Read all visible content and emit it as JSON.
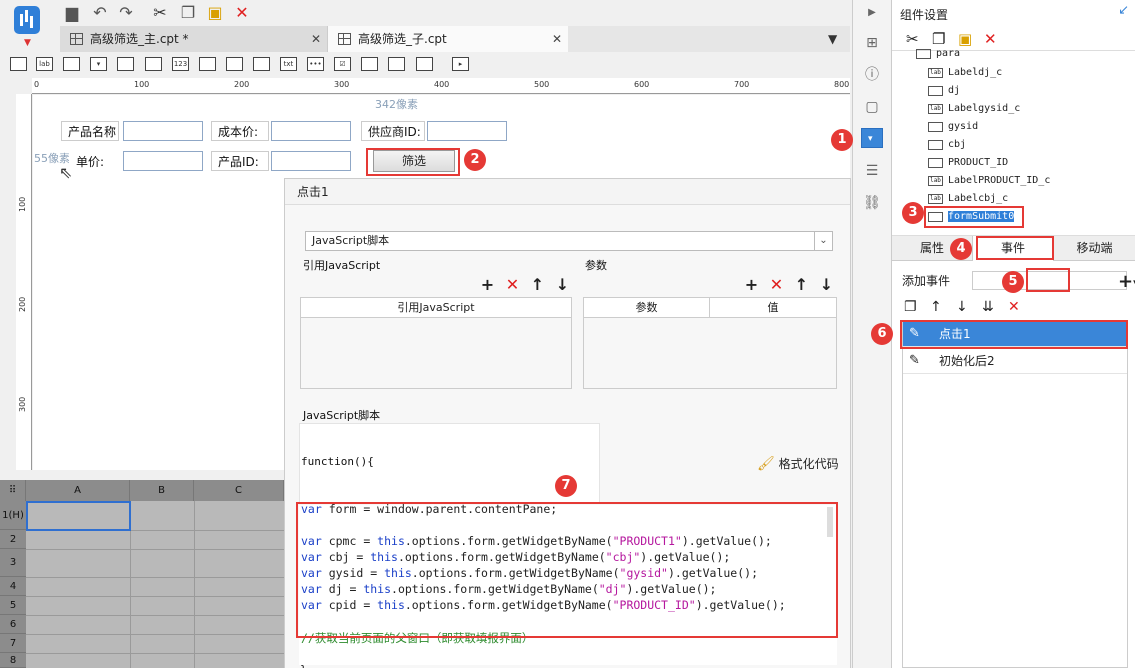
{
  "tabs": [
    {
      "label": "高级筛选_主.cpt *"
    },
    {
      "label": "高级筛选_子.cpt"
    }
  ],
  "ruler": {
    "top_ticks": [
      "0",
      "100",
      "200",
      "300",
      "400",
      "500",
      "600",
      "700",
      "800"
    ],
    "left_ticks": [
      "100",
      "200",
      "300"
    ],
    "width_readout": "342像素",
    "height_readout": "55像素"
  },
  "form": {
    "labels": {
      "product_name": "产品名称",
      "cost_price": "成本价:",
      "supplier_id": "供应商ID:",
      "unit_price": "单价:",
      "product_id": "产品ID:"
    },
    "filter_button": "筛选"
  },
  "dialog": {
    "title": "点击1",
    "type_select": "JavaScript脚本",
    "ref_js_label": "引用JavaScript",
    "params_label": "参数",
    "ref_js_header": "引用JavaScript",
    "param_col": "参数",
    "value_col": "值",
    "script_label": "JavaScript脚本",
    "function_head": "function(){",
    "format_code": "格式化代码",
    "closing_brace": "}",
    "code": {
      "l1a": "var",
      "l1b": " form = window.parent.contentPane;",
      "l2a": "var",
      "l2b": " cpmc = ",
      "l2c": "this",
      "l2d": ".options.form.getWidgetByName(",
      "l2e": "\"PRODUCT1\"",
      "l2f": ").getValue();",
      "l3a": "var",
      "l3b": " cbj = ",
      "l3c": "this",
      "l3d": ".options.form.getWidgetByName(",
      "l3e": "\"cbj\"",
      "l3f": ").getValue();",
      "l4a": "var",
      "l4b": " gysid = ",
      "l4c": "this",
      "l4d": ".options.form.getWidgetByName(",
      "l4e": "\"gysid\"",
      "l4f": ").getValue();",
      "l5a": "var",
      "l5b": " dj = ",
      "l5c": "this",
      "l5d": ".options.form.getWidgetByName(",
      "l5e": "\"dj\"",
      "l5f": ").getValue();",
      "l6a": "var",
      "l6b": " cpid = ",
      "l6c": "this",
      "l6d": ".options.form.getWidgetByName(",
      "l6e": "\"PRODUCT_ID\"",
      "l6f": ").getValue();",
      "l7": "//获取当前页面的父窗口（即获取填报界面）"
    }
  },
  "sheet": {
    "columns": [
      "A",
      "B",
      "C"
    ],
    "rows": [
      "1(H)",
      "2",
      "3",
      "4",
      "5",
      "6",
      "7",
      "8"
    ]
  },
  "right_panel": {
    "title": "组件设置",
    "tree": [
      {
        "label": "para"
      },
      {
        "label": "Labeldj_c"
      },
      {
        "label": "dj"
      },
      {
        "label": "Labelgysid_c"
      },
      {
        "label": "gysid"
      },
      {
        "label": "cbj"
      },
      {
        "label": "PRODUCT_ID"
      },
      {
        "label": "LabelPRODUCT_ID_c"
      },
      {
        "label": "Labelcbj_c"
      },
      {
        "label": "formSubmit0"
      }
    ],
    "tabs": {
      "props": "属性",
      "events": "事件",
      "mobile": "移动端"
    },
    "add_event": "添加事件",
    "events": [
      {
        "label": "点击1"
      },
      {
        "label": "初始化后2"
      }
    ]
  },
  "callouts": [
    "1",
    "2",
    "3",
    "4",
    "5",
    "6",
    "7"
  ],
  "colors": {
    "accent": "#2f7fd8",
    "callout": "#e53935"
  }
}
